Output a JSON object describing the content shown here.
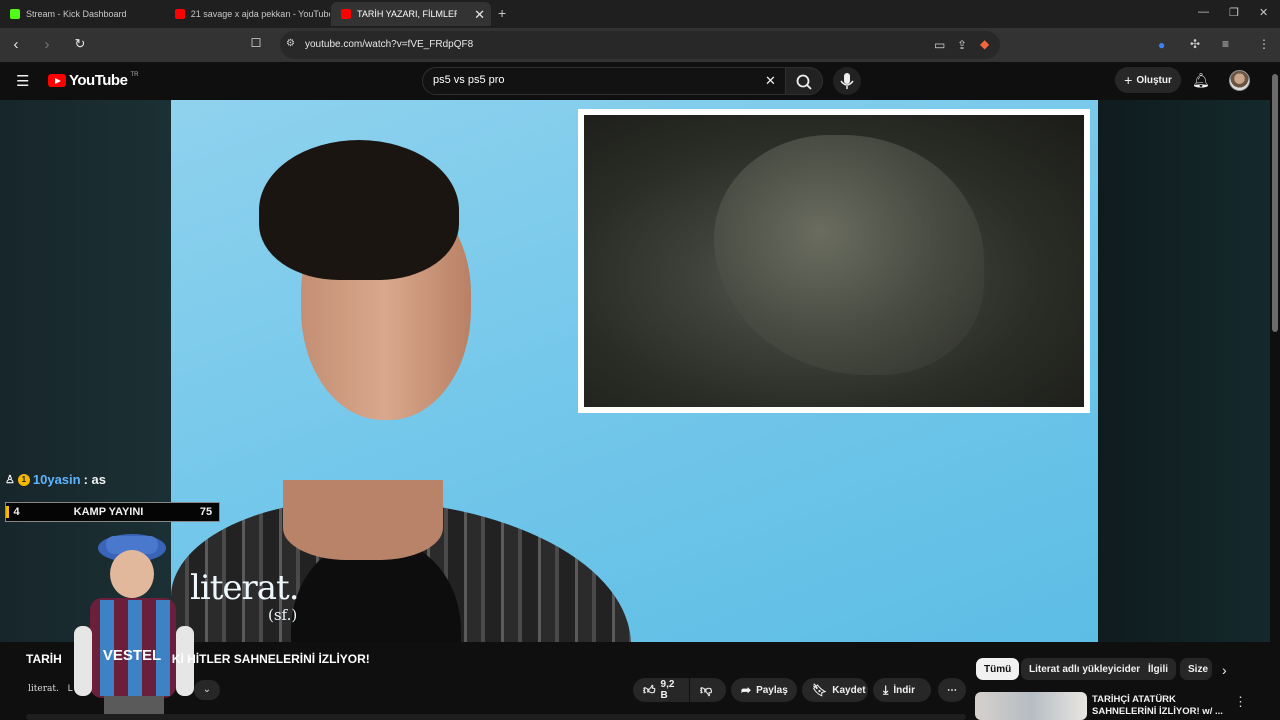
{
  "browser": {
    "tabs": [
      {
        "title": "Stream - Kick Dashboard",
        "icon": "kick-icon",
        "color": "#53fc18"
      },
      {
        "title": "21 savage x ajda pekkan - YouTube",
        "icon": "youtube-icon",
        "color": "#ff0000"
      },
      {
        "title": "TARİH YAZARI, FİLMLERDE",
        "icon": "youtube-icon",
        "color": "#ff0000"
      }
    ],
    "url": "youtube.com/watch?v=fVE_FRdpQF8"
  },
  "youtube": {
    "logo_text": "YouTube",
    "country_code": "TR",
    "search_value": "ps5 vs ps5 pro",
    "create_label": "Oluştur"
  },
  "video": {
    "watermark": "literat.",
    "watermark_sub": "(sf.)",
    "title": "TARİH YAZARI, FİLMLERDEKİ HİTLER SAHNELERİNİ İZLİYOR!",
    "title_visible_left": "TARİH",
    "title_visible_right": "Kİ HİTLER SAHNELERİNİ İZLİYOR!",
    "channel_logo": "literat.",
    "channel_initial": "L",
    "actions": {
      "likes": "9,2 B",
      "share": "Paylaş",
      "save": "Kaydet",
      "download": "İndir"
    }
  },
  "overlay": {
    "chat_badge_count": "1",
    "chat_user": "10yasin",
    "chat_message": ": as",
    "bar_left": "4",
    "bar_title": "KAMP YAYINI",
    "bar_right": "75",
    "mascot_shirt_text": "VESTEL"
  },
  "chips": [
    "Tümü",
    "Literat adlı yükleyiciden",
    "İlgili",
    "Size"
  ],
  "related": {
    "title": "TARİHÇİ ATATÜRK SAHNELERİNİ İZLİYOR! w/ ..."
  }
}
